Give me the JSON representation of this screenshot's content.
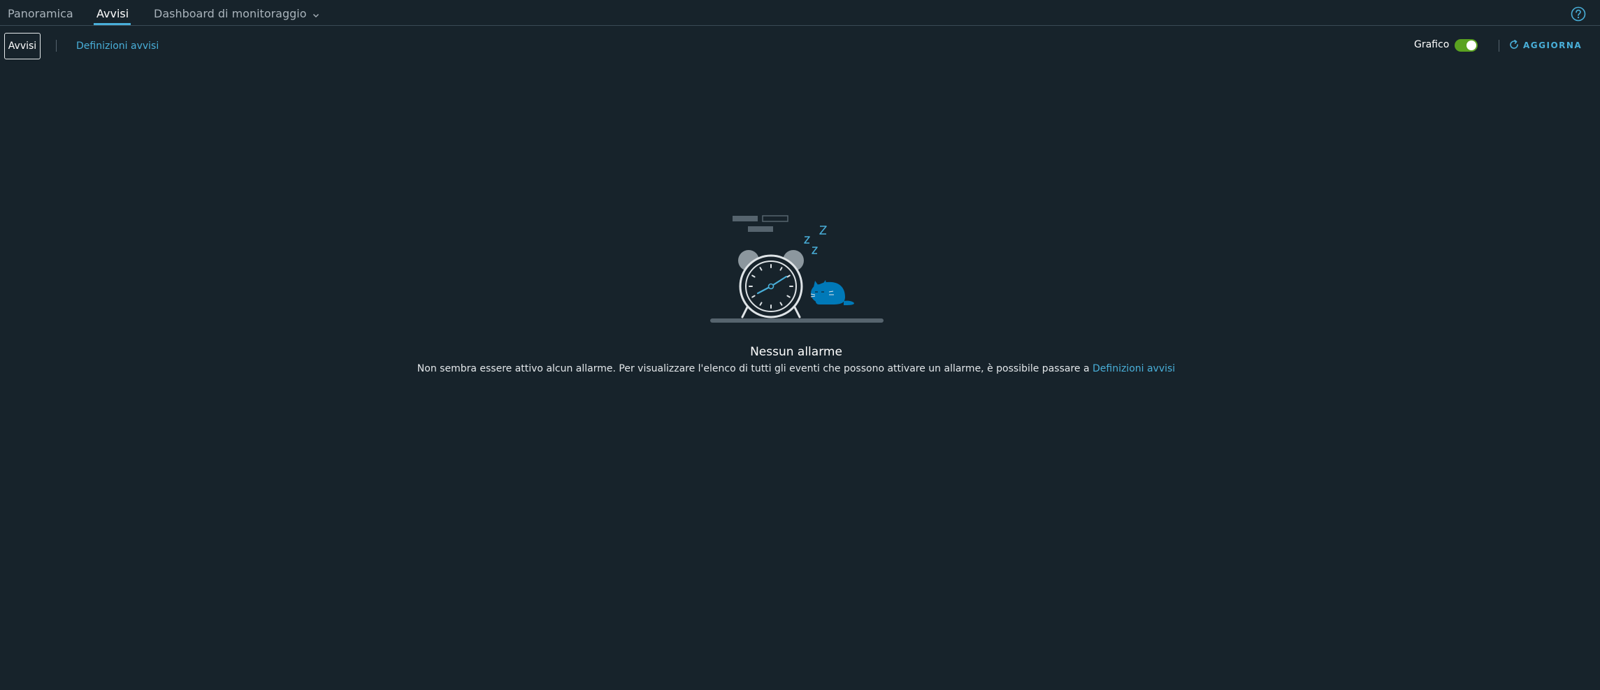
{
  "tabs": [
    {
      "label": "Panoramica",
      "active": false
    },
    {
      "label": "Avvisi",
      "active": true
    },
    {
      "label": "Dashboard di monitoraggio",
      "active": false,
      "has_dropdown": true
    }
  ],
  "toolbar": {
    "primary_button": "Avvisi",
    "definitions_link": "Definizioni avvisi",
    "chart_toggle_label": "Grafico",
    "chart_toggle_on": true,
    "refresh_label": "AGGIORNA"
  },
  "icons": {
    "help": "help-circle-icon",
    "refresh": "refresh-icon",
    "dropdown": "chevron-down-icon"
  },
  "empty_state": {
    "title": "Nessun allarme",
    "description": "Non sembra essere attivo alcun allarme. Per visualizzare l'elenco di tutti gli eventi che possono attivare un allarme, è possibile passare a",
    "link_label": "Definizioni avvisi",
    "illustration_text": "Z z z"
  },
  "colors": {
    "background": "#17232b",
    "accent": "#49afd9",
    "toggle_on": "#5aa220",
    "text": "#ffffff"
  }
}
